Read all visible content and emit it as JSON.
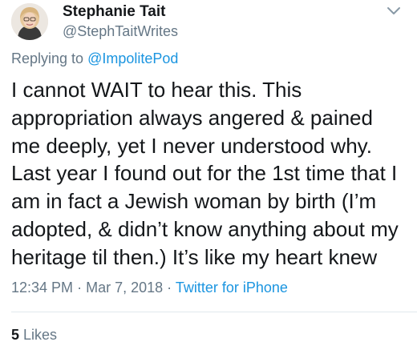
{
  "tweet": {
    "author": {
      "display_name": "Stephanie Tait",
      "handle": "@StephTaitWrites",
      "avatar_icon": "profile-photo"
    },
    "replying_to_prefix": "Replying to",
    "replying_to_handle": "@ImpolitePod",
    "text_lines": [
      "I cannot WAIT to hear this. This",
      "appropriation always angered & pained",
      "me deeply, yet I never understood why.",
      "Last year I found out for the 1st time that I",
      "am in fact a Jewish woman by birth (I’m",
      "adopted, & didn’t know anything about my",
      "heritage til then.) It’s like my heart knew"
    ],
    "time": "12:34 PM",
    "separator": "·",
    "date": "Mar 7, 2018",
    "source": "Twitter for iPhone",
    "likes_count": "5",
    "likes_label": "Likes"
  },
  "menu_icon": "chevron-down-icon",
  "colors": {
    "text": "#14171a",
    "secondary": "#657786",
    "link": "#1b95e0",
    "divider": "#e1e8ed"
  }
}
